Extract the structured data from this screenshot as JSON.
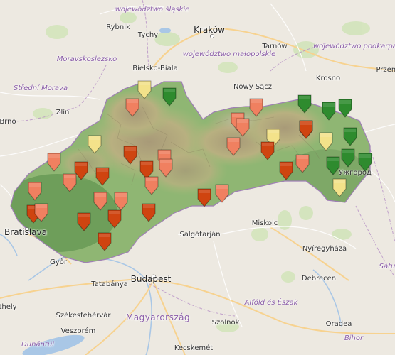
{
  "map": {
    "labels": {
      "wojewodztwo_slaskie": "województwo śląskie",
      "rybnik": "Rybnik",
      "tychy": "Tychy",
      "krakow": "Kraków",
      "tarnow": "Tarnów",
      "wojewodztwo_podkarpackie": "województwo podkarpackie",
      "moravskoslezsko": "Moravskoslezsko",
      "bielsko_biala": "Bielsko-Biała",
      "wojewodztwo_malopolskie": "województwo małopolskie",
      "krosno": "Krosno",
      "przem": "Przem",
      "stredni_morava": "Střední Morava",
      "nowy_sacz": "Nowy Sącz",
      "zlin": "Zlín",
      "brno": "Brno",
      "uzhhorod": "Ужгород",
      "bratislava": "Bratislava",
      "salgotarjan": "Salgótarján",
      "miskolc": "Miskolc",
      "nyiregyhaza": "Nyíregyháza",
      "gyor": "Győr",
      "budapest": "Budapest",
      "tatabanya": "Tatabánya",
      "debrecen": "Debrecen",
      "thely": "thely",
      "szekesfehervar": "Székesfehérvár",
      "magyarorszag": "Magyarország",
      "szolnok": "Szolnok",
      "alfold_es_eszak": "Alföld és Észak",
      "veszprem": "Veszprém",
      "oradea": "Oradea",
      "bihor": "Bihor",
      "dunantul": "Dunántúl",
      "kecskemet": "Kecskemét",
      "satu": "Satu"
    },
    "marker_colors": {
      "dark_green": "#2e8b2e",
      "pale_yellow": "#f3e28a",
      "light_orange": "#f08060",
      "dark_orange": "#cf4410"
    },
    "markers": [
      {
        "color": "pale_yellow"
      },
      {
        "color": "dark_green"
      },
      {
        "color": "light_orange"
      },
      {
        "color": "pale_yellow"
      },
      {
        "color": "light_orange"
      },
      {
        "color": "dark_orange"
      },
      {
        "color": "dark_orange"
      },
      {
        "color": "dark_orange"
      },
      {
        "color": "light_orange"
      },
      {
        "color": "light_orange"
      },
      {
        "color": "dark_orange"
      },
      {
        "color": "light_orange"
      },
      {
        "color": "light_orange"
      },
      {
        "color": "light_orange"
      },
      {
        "color": "dark_orange"
      },
      {
        "color": "light_orange"
      },
      {
        "color": "dark_orange"
      },
      {
        "color": "light_orange"
      },
      {
        "color": "light_orange"
      },
      {
        "color": "dark_orange"
      },
      {
        "color": "dark_orange"
      },
      {
        "color": "dark_orange"
      },
      {
        "color": "dark_orange"
      },
      {
        "color": "light_orange"
      },
      {
        "color": "light_orange"
      },
      {
        "color": "light_orange"
      },
      {
        "color": "light_orange"
      },
      {
        "color": "pale_yellow"
      },
      {
        "color": "dark_orange"
      },
      {
        "color": "dark_orange"
      },
      {
        "color": "light_orange"
      },
      {
        "color": "dark_orange"
      },
      {
        "color": "dark_green"
      },
      {
        "color": "dark_green"
      },
      {
        "color": "dark_green"
      },
      {
        "color": "dark_orange"
      },
      {
        "color": "dark_green"
      },
      {
        "color": "pale_yellow"
      },
      {
        "color": "dark_green"
      },
      {
        "color": "dark_green"
      },
      {
        "color": "dark_green"
      },
      {
        "color": "pale_yellow"
      },
      {
        "color": "light_orange"
      }
    ]
  }
}
